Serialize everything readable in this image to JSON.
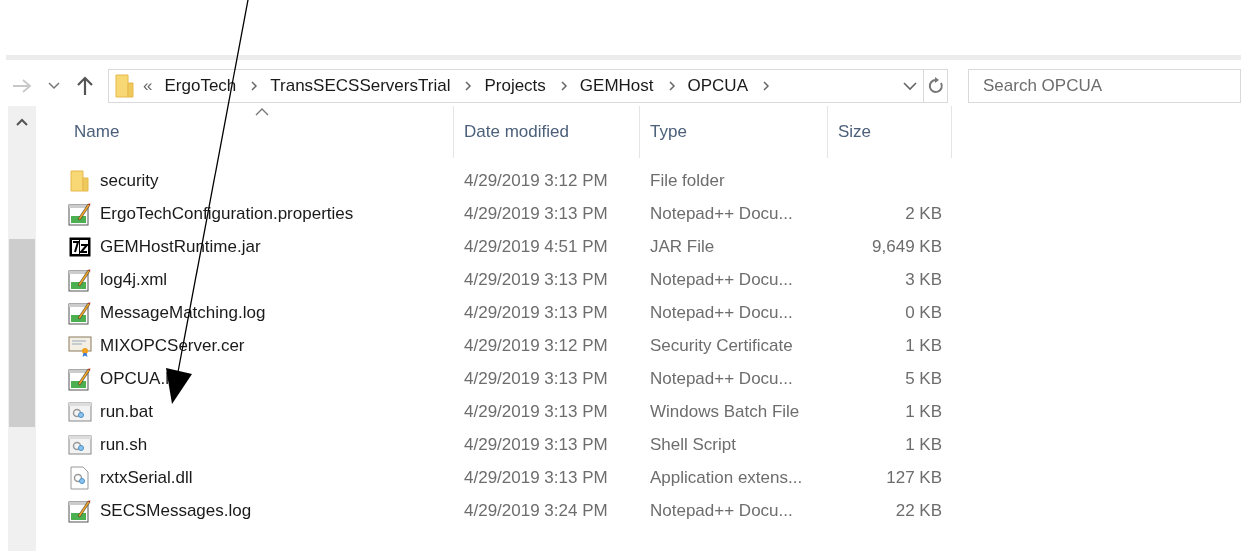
{
  "address_bar": {
    "overflow": "«",
    "crumbs": [
      "ErgoTech",
      "TransSECSServersTrial",
      "Projects",
      "GEMHost",
      "OPCUA"
    ]
  },
  "search": {
    "placeholder": "Search OPCUA"
  },
  "table": {
    "columns": [
      {
        "label": "Name",
        "sorted": true
      },
      {
        "label": "Date modified",
        "sorted": false
      },
      {
        "label": "Type",
        "sorted": false
      },
      {
        "label": "Size",
        "sorted": false
      }
    ],
    "rows": [
      {
        "kind": "folder",
        "name": "security",
        "date": "4/29/2019 3:12 PM",
        "type": "File folder",
        "size": ""
      },
      {
        "kind": "notepad",
        "name": "ErgoTechConfiguration.properties",
        "date": "4/29/2019 3:13 PM",
        "type": "Notepad++ Docu...",
        "size": "2 KB"
      },
      {
        "kind": "archive",
        "name": "GEMHostRuntime.jar",
        "date": "4/29/2019 4:51 PM",
        "type": "JAR File",
        "size": "9,649 KB"
      },
      {
        "kind": "notepad",
        "name": "log4j.xml",
        "date": "4/29/2019 3:13 PM",
        "type": "Notepad++ Docu...",
        "size": "3 KB"
      },
      {
        "kind": "notepad",
        "name": "MessageMatching.log",
        "date": "4/29/2019 3:13 PM",
        "type": "Notepad++ Docu...",
        "size": "0 KB"
      },
      {
        "kind": "certificate",
        "name": "MIXOPCServer.cer",
        "date": "4/29/2019 3:12 PM",
        "type": "Security Certificate",
        "size": "1 KB"
      },
      {
        "kind": "notepad",
        "name": "OPCUA.l",
        "date": "4/29/2019 3:13 PM",
        "type": "Notepad++ Docu...",
        "size": "5 KB"
      },
      {
        "kind": "script",
        "name": "run.bat",
        "date": "4/29/2019 3:13 PM",
        "type": "Windows Batch File",
        "size": "1 KB"
      },
      {
        "kind": "script",
        "name": "run.sh",
        "date": "4/29/2019 3:13 PM",
        "type": "Shell Script",
        "size": "1 KB"
      },
      {
        "kind": "library",
        "name": "rxtxSerial.dll",
        "date": "4/29/2019 3:13 PM",
        "type": "Application extens...",
        "size": "127 KB"
      },
      {
        "kind": "notepad",
        "name": "SECSMessages.log",
        "date": "4/29/2019 3:24 PM",
        "type": "Notepad++ Docu...",
        "size": "22 KB"
      }
    ]
  }
}
